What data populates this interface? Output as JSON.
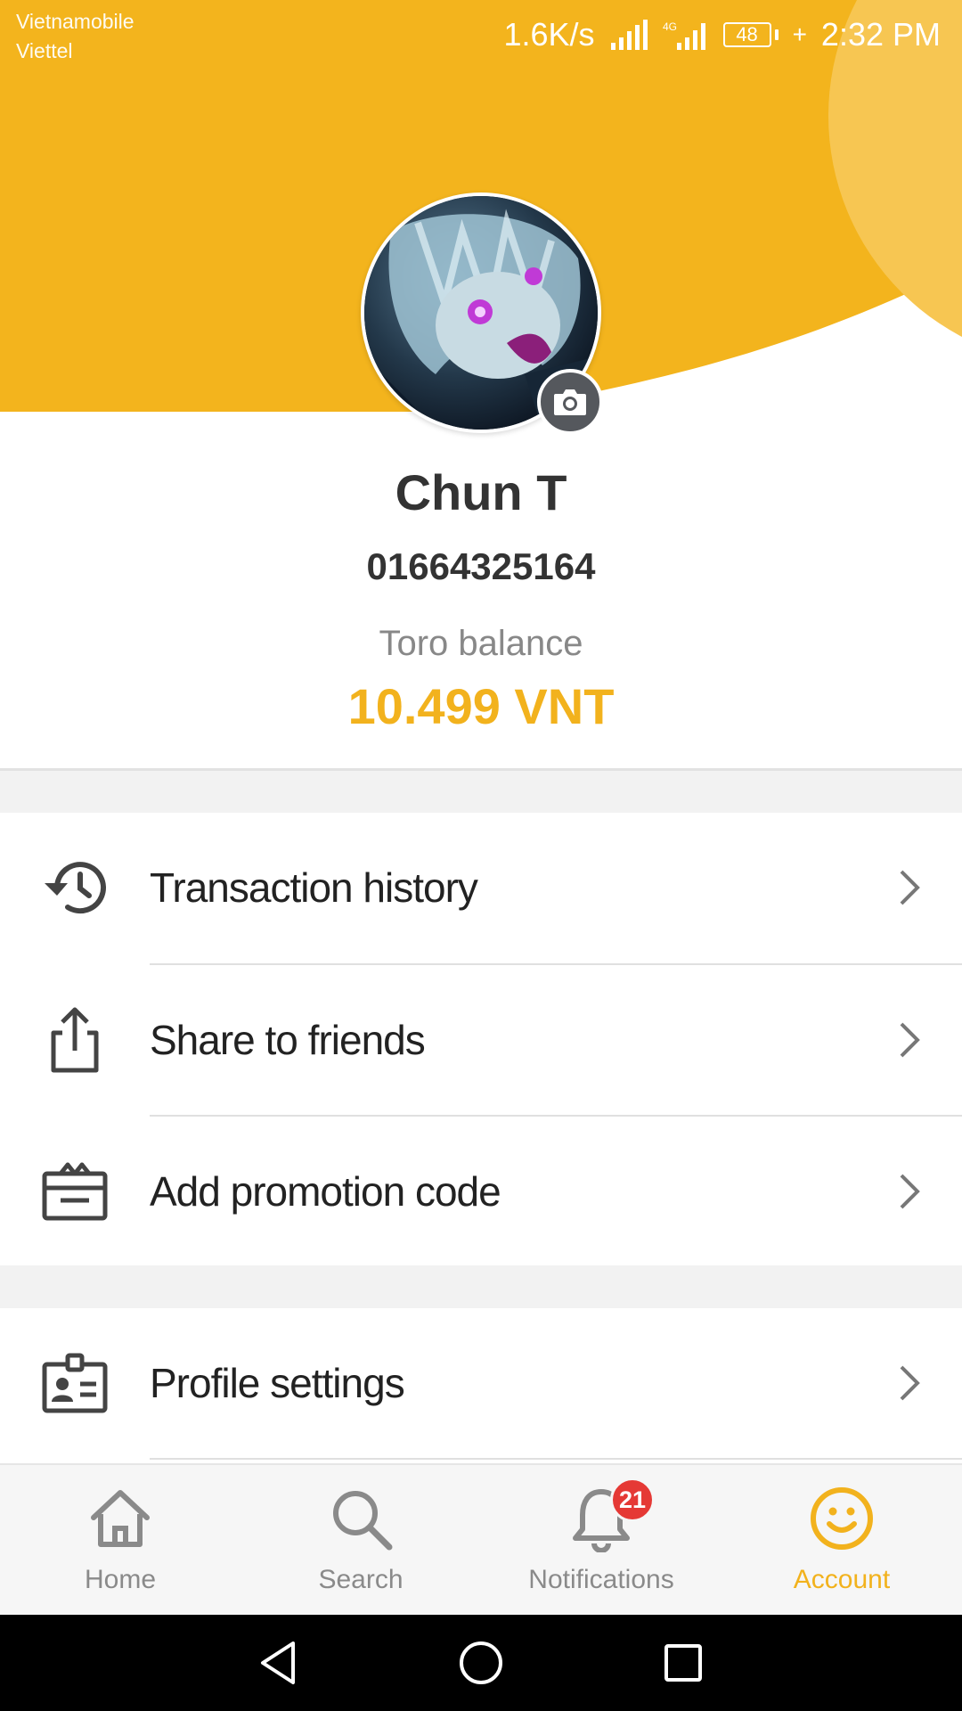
{
  "status_bar": {
    "carrier_1": "Vietnamobile",
    "carrier_2": "Viettel",
    "net_speed": "1.6K/s",
    "battery_level": "48",
    "time": "2:32 PM"
  },
  "colors": {
    "accent": "#f2b21d",
    "badge": "#e53935"
  },
  "profile": {
    "name": "Chun T",
    "phone": "01664325164",
    "balance_label": "Toro balance",
    "balance_value": "10.499 VNT"
  },
  "menu": {
    "items": [
      {
        "label": "Transaction history",
        "icon": "history-icon"
      },
      {
        "label": "Share to friends",
        "icon": "share-icon"
      },
      {
        "label": "Add promotion code",
        "icon": "gift-icon"
      },
      {
        "label": "Profile settings",
        "icon": "profile-card-icon"
      }
    ]
  },
  "bottom_nav": {
    "items": [
      {
        "label": "Home",
        "icon": "home-icon"
      },
      {
        "label": "Search",
        "icon": "search-icon"
      },
      {
        "label": "Notifications",
        "icon": "bell-icon",
        "badge": "21"
      },
      {
        "label": "Account",
        "icon": "smiley-icon",
        "active": true
      }
    ]
  }
}
